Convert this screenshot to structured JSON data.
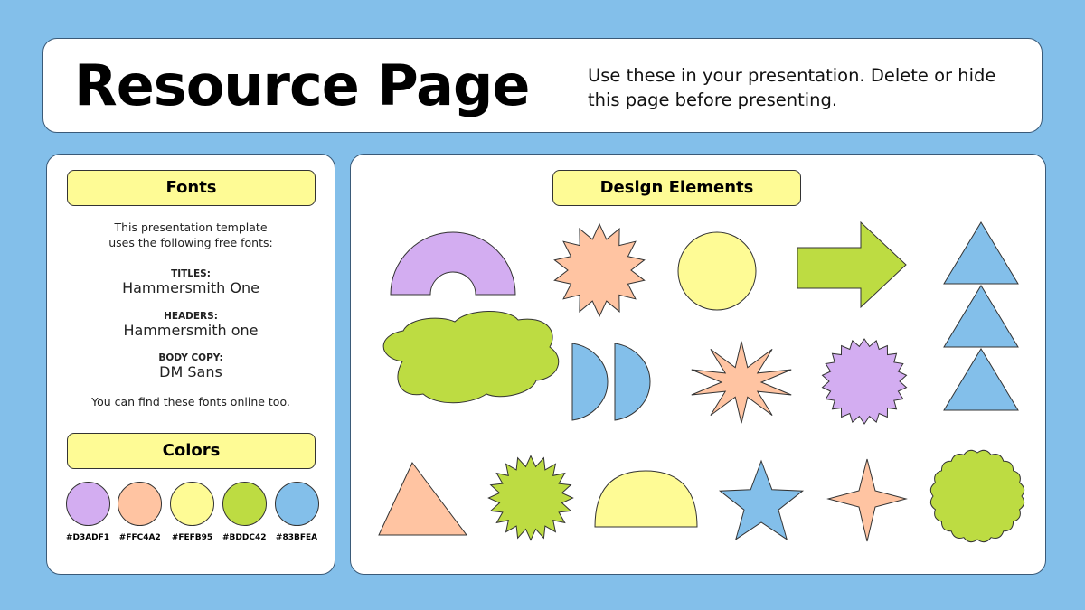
{
  "header": {
    "title": "Resource Page",
    "subtitle": "Use these in your presentation. Delete or hide this page before presenting."
  },
  "fonts": {
    "heading": "Fonts",
    "intro_line1": "This presentation template",
    "intro_line2": "uses the following free fonts:",
    "entries": [
      {
        "label": "TITLES:",
        "name": "Hammersmith One"
      },
      {
        "label": "HEADERS:",
        "name": "Hammersmith one"
      },
      {
        "label": "BODY COPY:",
        "name": "DM Sans"
      }
    ],
    "outro": "You can find these fonts online too."
  },
  "colors": {
    "heading": "Colors",
    "swatches": [
      {
        "hex": "#D3ADF1",
        "label": "#D3ADF1"
      },
      {
        "hex": "#FFC4A2",
        "label": "#FFC4A2"
      },
      {
        "hex": "#FEFB95",
        "label": "#FEFB95"
      },
      {
        "hex": "#BDDC42",
        "label": "#BDDC42"
      },
      {
        "hex": "#83BFEA",
        "label": "#83BFEA"
      }
    ]
  },
  "design_elements": {
    "heading": "Design Elements",
    "shapes": [
      {
        "name": "rainbow-arch-shape",
        "color": "#D3ADF1"
      },
      {
        "name": "starburst-shape",
        "color": "#FFC4A2"
      },
      {
        "name": "circle-shape",
        "color": "#FEFB95"
      },
      {
        "name": "right-arrow-shape",
        "color": "#BDDC42"
      },
      {
        "name": "triangle-stack-shape",
        "color": "#83BFEA"
      },
      {
        "name": "cloud-shape",
        "color": "#BDDC42"
      },
      {
        "name": "double-half-circle-shape",
        "color": "#83BFEA"
      },
      {
        "name": "spiky-star-shape",
        "color": "#FFC4A2"
      },
      {
        "name": "gear-badge-shape",
        "color": "#D3ADF1"
      },
      {
        "name": "triangle-shape",
        "color": "#FFC4A2"
      },
      {
        "name": "zigzag-seal-shape",
        "color": "#BDDC42"
      },
      {
        "name": "half-dome-shape",
        "color": "#FEFB95"
      },
      {
        "name": "five-point-star-shape",
        "color": "#83BFEA"
      },
      {
        "name": "four-point-star-shape",
        "color": "#FFC4A2"
      },
      {
        "name": "scalloped-oval-shape",
        "color": "#BDDC42"
      }
    ]
  }
}
